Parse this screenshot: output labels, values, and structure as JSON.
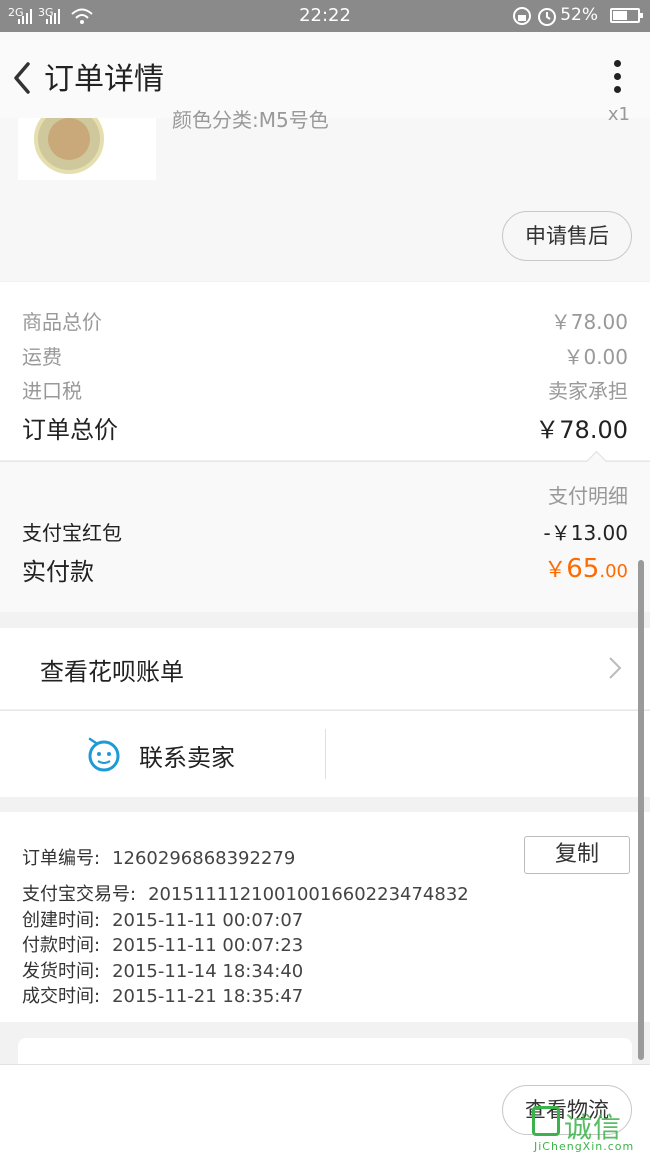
{
  "status_bar": {
    "signal_1": "2G",
    "signal_2": "3G",
    "time": "22:22",
    "battery": "52%"
  },
  "header": {
    "title": "订单详情"
  },
  "product": {
    "spec": "颜色分类:M5号色",
    "qty": "x1",
    "after_sale_button": "申请售后"
  },
  "prices": {
    "goods_total_label": "商品总价",
    "goods_total_value": "￥78.00",
    "shipping_label": "运费",
    "shipping_value": "￥0.00",
    "import_tax_label": "进口税",
    "import_tax_value": "卖家承担",
    "order_total_label": "订单总价",
    "order_total_value": "￥78.00"
  },
  "payment": {
    "detail_link": "支付明细",
    "red_packet_label": "支付宝红包",
    "red_packet_value": "-￥13.00",
    "paid_label": "实付款",
    "paid_currency": "￥",
    "paid_integer": "65",
    "paid_decimal": ".00"
  },
  "huabei": {
    "label": "查看花呗账单"
  },
  "contact": {
    "label": "联系卖家"
  },
  "order_info": {
    "order_no_label": "订单编号:",
    "order_no": "1260296868392279",
    "copy_button": "复制",
    "alipay_no_label": "支付宝交易号:",
    "alipay_no": "2015111121001001660223474832",
    "created_label": "创建时间:",
    "created": "2015-11-11 00:07:07",
    "paid_label": "付款时间:",
    "paid": "2015-11-11 00:07:23",
    "shipped_label": "发货时间:",
    "shipped": "2015-11-14 18:34:40",
    "completed_label": "成交时间:",
    "completed": "2015-11-21 18:35:47"
  },
  "bottom": {
    "logistics_button": "查看物流"
  },
  "watermark": {
    "text": "诚信",
    "sub": "JiChengXin.com"
  },
  "colors": {
    "accent_orange": "#ff6a00",
    "contact_blue": "#1e9bd7",
    "watermark_green": "#3cb34a"
  }
}
